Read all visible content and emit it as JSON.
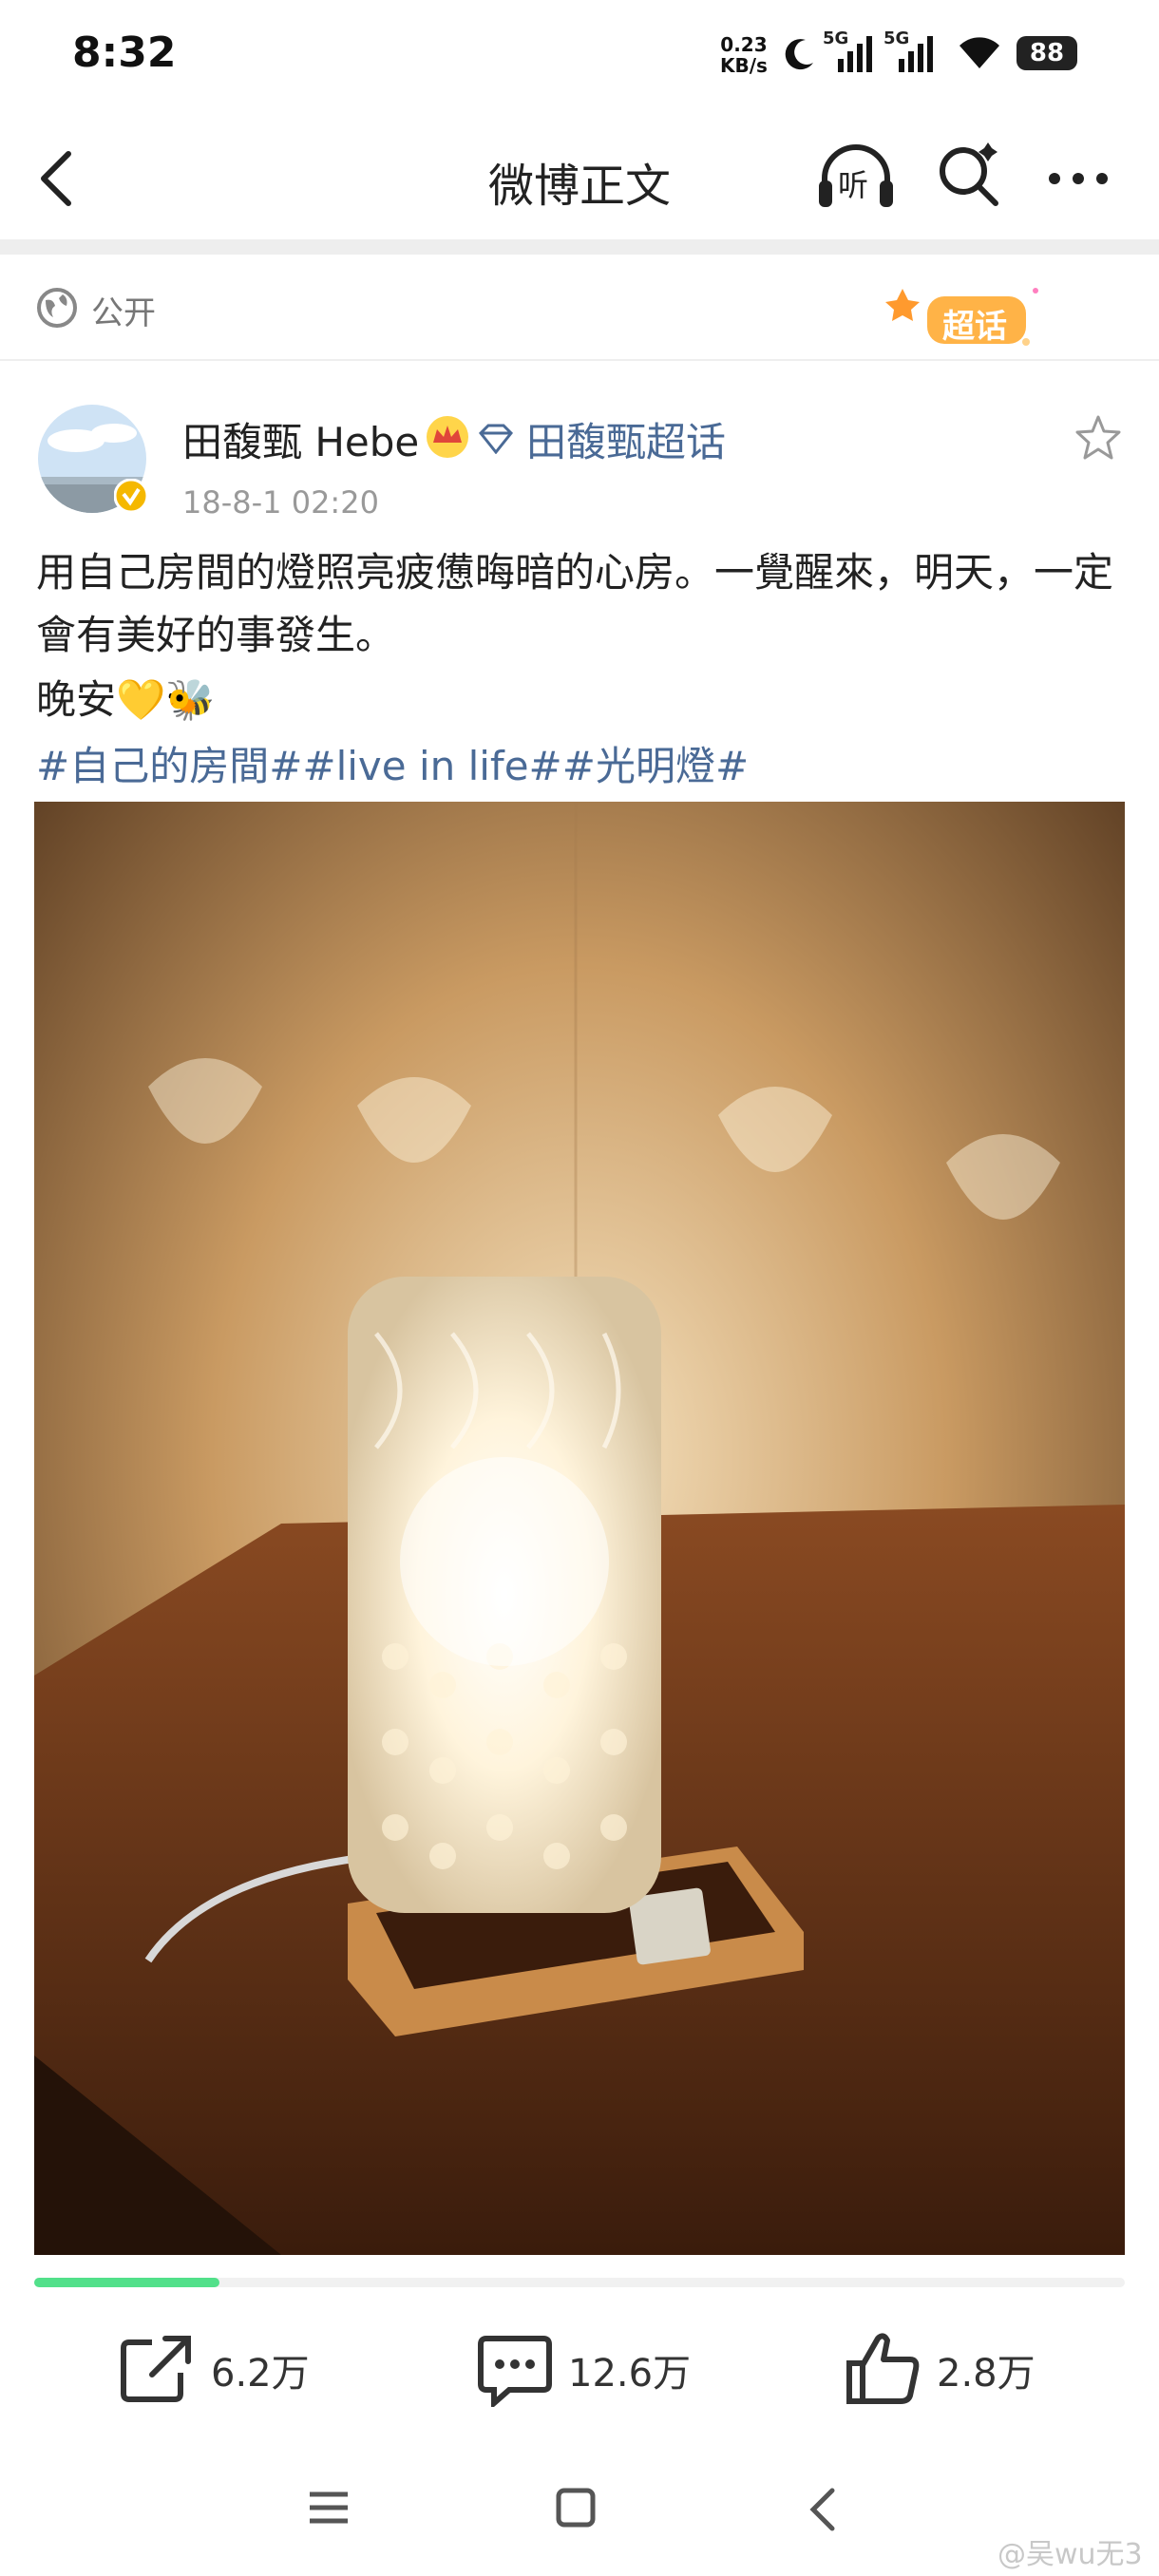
{
  "status_bar": {
    "time": "8:32",
    "net_speed_value": "0.23",
    "net_speed_unit": "KB/s",
    "sim1": "5G",
    "sim2": "5G",
    "battery": "88",
    "icons": [
      "moon-icon",
      "signal-icon",
      "signal-icon",
      "wifi-icon",
      "battery-icon"
    ]
  },
  "nav": {
    "title": "微博正文",
    "icons": [
      "back-arrow-icon",
      "listen-headphones-icon",
      "search-icon",
      "more-icon"
    ],
    "listen_label": "听"
  },
  "visibility": {
    "label": "公开",
    "super_topic_badge": "超话"
  },
  "post": {
    "author_name": "田馥甄 Hebe",
    "super_topic_link": "田馥甄超话",
    "time": "18-8-1 02:20",
    "text": "用自己房間的燈照亮疲憊晦暗的心房。一覺醒來，明天，一定會有美好的事發生。",
    "greeting": "晚安💛🐝",
    "tags": "#自己的房間##live in life##光明燈#",
    "photo_progress": 0.17
  },
  "actions": {
    "repost_count": "6.2万",
    "comment_count": "12.6万",
    "like_count": "2.8万"
  },
  "system_nav": {
    "icons": [
      "menu-icon",
      "home-square-icon",
      "back-chevron-icon"
    ]
  },
  "watermark": "@吴wu无3",
  "colors": {
    "link": "#4a6a96",
    "progress": "#52e08a",
    "verified": "#f5b800"
  }
}
